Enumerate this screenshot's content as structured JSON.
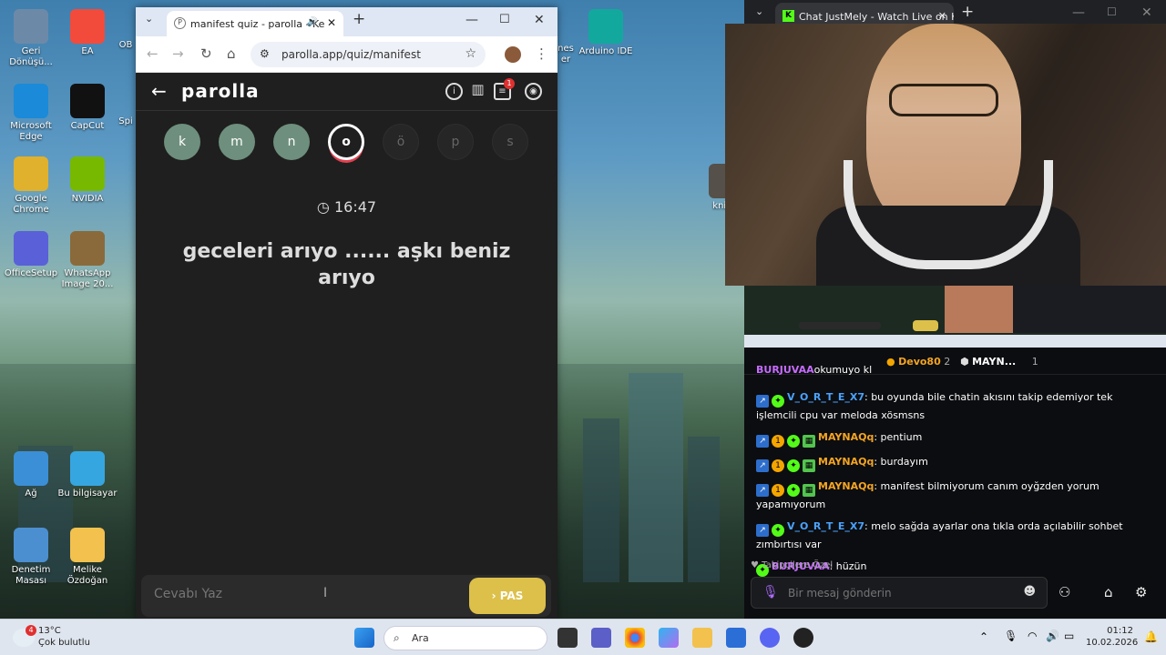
{
  "desktop": {
    "icons": [
      {
        "label": "Geri Dönüşü...",
        "icon": "recycle-bin-icon",
        "color": "#6c8aa8"
      },
      {
        "label": "EA",
        "icon": "ea-icon",
        "color": "#f24b3c"
      },
      {
        "label": "Microsoft Edge",
        "icon": "edge-icon",
        "color": "#1b8ad8"
      },
      {
        "label": "CapCut",
        "icon": "capcut-icon",
        "color": "#111111"
      },
      {
        "label": "Google Chrome",
        "icon": "chrome-icon",
        "color": "#e0b12c"
      },
      {
        "label": "NVIDIA",
        "icon": "nvidia-icon",
        "color": "#76b900"
      },
      {
        "label": "OfficeSetup",
        "icon": "office-icon",
        "color": "#5a60d8"
      },
      {
        "label": "WhatsApp Image 20...",
        "icon": "image-icon",
        "color": "#8a6a3a"
      },
      {
        "label": "Ağ",
        "icon": "network-icon",
        "color": "#3b8fd6"
      },
      {
        "label": "Bu bilgisayar",
        "icon": "computer-icon",
        "color": "#36a6e0"
      },
      {
        "label": "Denetim Masası",
        "icon": "control-panel-icon",
        "color": "#4b8fd0"
      },
      {
        "label": "Melike Özdoğan",
        "icon": "folder-icon",
        "color": "#f2c14e"
      },
      {
        "label": "Arduino IDE",
        "icon": "arduino-icon",
        "color": "#13a89e"
      },
      {
        "label": "kniwq",
        "icon": "image-icon",
        "color": "#55504a"
      }
    ],
    "partial_labels": [
      "OB",
      "Spi",
      "nes",
      "er"
    ]
  },
  "browser_left": {
    "tab_title": "manifest quiz - parolla - Ke",
    "url": "parolla.app/quiz/manifest"
  },
  "parolla": {
    "logo": "parolla",
    "notification_count": "1",
    "letters": [
      {
        "char": "k",
        "state": "done"
      },
      {
        "char": "m",
        "state": "done"
      },
      {
        "char": "n",
        "state": "done"
      },
      {
        "char": "o",
        "state": "current"
      },
      {
        "char": "ö",
        "state": "todo"
      },
      {
        "char": "p",
        "state": "todo"
      },
      {
        "char": "s",
        "state": "todo"
      }
    ],
    "timer": "16:47",
    "question": "geceleri arıyo ...... aşkı beniz arıyo",
    "answer_placeholder": "Cevabı Yaz",
    "pass_label": "PAS"
  },
  "browser_right": {
    "tab_title": "Chat JustMely - Watch Live on K"
  },
  "chat": {
    "top_gifters": [
      {
        "name": "Devo80",
        "count": "2"
      },
      {
        "name": "MAYN...",
        "count": "1"
      }
    ],
    "cut_message": {
      "user": "BURJUVAA",
      "text": "okumuyo kl"
    },
    "messages": [
      {
        "user": "V_O_R_T_E_X7",
        "color": "blue",
        "text": ": bu oyunda bile chatin akısını takip edemiyor tek işlemcili cpu var meloda xösmsns",
        "gold": ""
      },
      {
        "user": "MAYNAQq",
        "color": "orange",
        "text": ": pentium",
        "gold": "1"
      },
      {
        "user": "MAYNAQq",
        "color": "orange",
        "text": ": burdayım",
        "gold": "1"
      },
      {
        "user": "MAYNAQq",
        "color": "orange",
        "text": ": manifest bilmiyorum canım oyğzden yorum yapamıyorum",
        "gold": "1"
      },
      {
        "user": "V_O_R_T_E_X7",
        "color": "blue",
        "text": ": melo sağda ayarlar ona tıkla orda açılabilir sohbet zımbırtısı var",
        "gold": ""
      },
      {
        "user": "BURJUVAA",
        "color": "purple",
        "text": ": hüzün",
        "gold": ""
      }
    ],
    "followers_only": "Takipçilere Özel",
    "input_placeholder": "Bir mesaj gönderin"
  },
  "taskbar": {
    "weather_temp": "13°C",
    "weather_desc": "Çok bulutlu",
    "weather_badge": "4",
    "search_label": "Ara",
    "time": "01:12",
    "date": "10.02.2026"
  }
}
